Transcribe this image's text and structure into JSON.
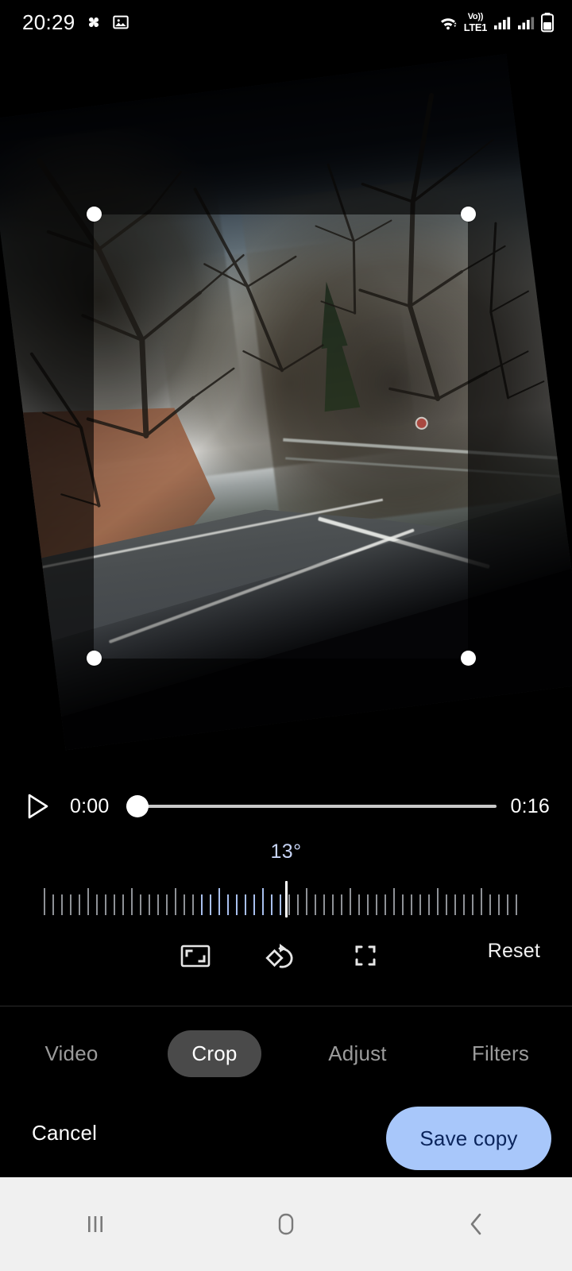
{
  "status_bar": {
    "time": "20:29",
    "left_icons": [
      "pinwheel-icon",
      "photo-icon"
    ],
    "network_label_top": "Vo))",
    "network_label_bottom": "LTE1",
    "right_icons": [
      "wifi-icon",
      "volte-icon",
      "signal-bars-icon",
      "signal-bars-2-icon",
      "battery-icon"
    ]
  },
  "editor": {
    "crop": {
      "handles": [
        "top-left",
        "top-right",
        "bottom-left",
        "bottom-right"
      ],
      "rotation_degrees": "13°"
    }
  },
  "player": {
    "play_icon": "play-triangle-icon",
    "current_time": "0:00",
    "total_time": "0:16",
    "progress_percent": 0
  },
  "tools": {
    "aspect_ratio_icon": "aspect-ratio-icon",
    "rotate_icon": "rotate-icon",
    "perspective_icon": "perspective-icon",
    "reset_label": "Reset"
  },
  "tabs": [
    {
      "label": "Video",
      "active": false
    },
    {
      "label": "Crop",
      "active": true
    },
    {
      "label": "Adjust",
      "active": false
    },
    {
      "label": "Filters",
      "active": false
    }
  ],
  "actions": {
    "cancel_label": "Cancel",
    "save_label": "Save copy"
  },
  "nav_bar": {
    "recents_icon": "recents-icon",
    "home_icon": "home-icon",
    "back_icon": "back-icon"
  },
  "colors": {
    "accent_button_bg": "#a8c7fa",
    "accent_button_text": "#0b255c",
    "dial_value": "#c7d4f5",
    "tab_active_bg": "#4a4a4a",
    "nav_bar_bg": "#f0f0f0",
    "background": "#000000"
  }
}
